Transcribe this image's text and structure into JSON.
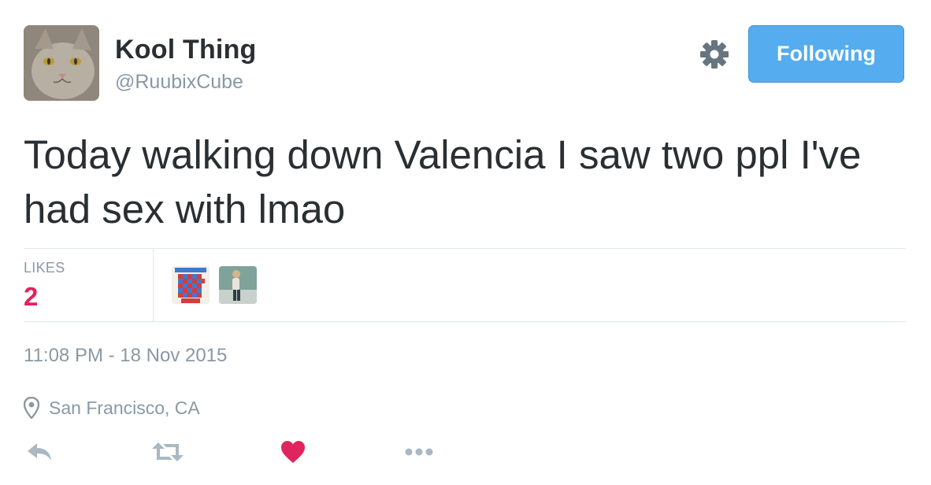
{
  "user": {
    "display_name": "Kool Thing",
    "handle": "@RuubixCube",
    "avatar_icon": "cat-photo-avatar"
  },
  "header": {
    "settings_icon": "gear-icon",
    "follow_button_label": "Following"
  },
  "tweet": {
    "text": "Today walking down Valencia I saw two ppl I've had sex with lmao",
    "timestamp": "11:08 PM - 18 Nov 2015",
    "location": "San Francisco, CA"
  },
  "stats": {
    "likes_label": "LIKES",
    "likes_count": "2",
    "likers": [
      {
        "icon": "buzzword-bingo-avatar"
      },
      {
        "icon": "person-photo-avatar"
      }
    ]
  },
  "actions": [
    {
      "icon": "reply-icon"
    },
    {
      "icon": "retweet-icon"
    },
    {
      "icon": "like-heart-icon"
    },
    {
      "icon": "more-icon"
    }
  ],
  "colors": {
    "accent_blue": "#55acee",
    "like_red": "#e0245e",
    "muted_text": "#8899a6",
    "primary_text": "#292f33",
    "divider": "#e1e8ed"
  }
}
